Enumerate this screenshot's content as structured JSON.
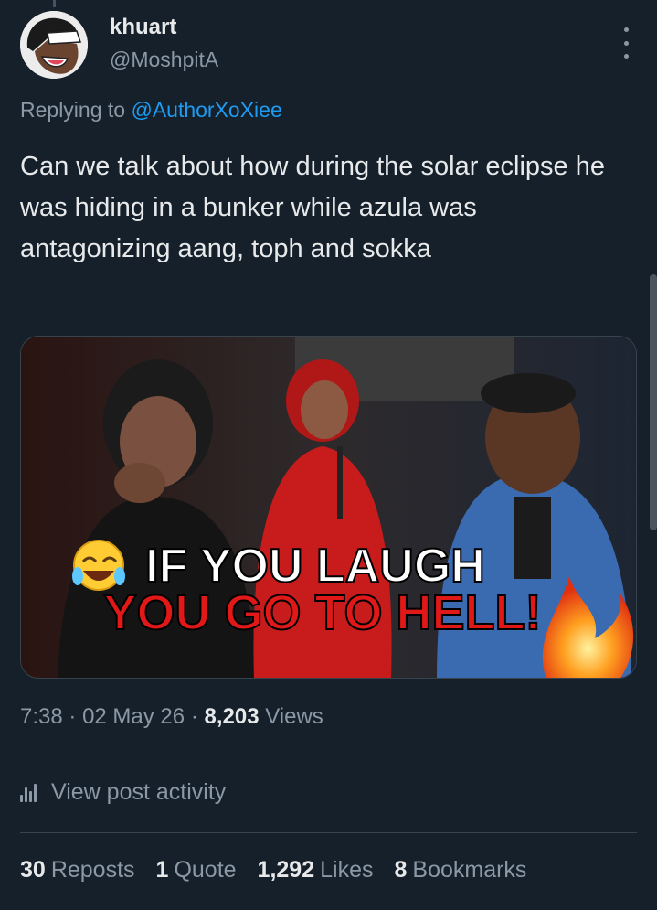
{
  "author": {
    "display_name": "khuart",
    "handle": "@MoshpitA"
  },
  "reply": {
    "prefix": "Replying to",
    "mention": "@AuthorXoXiee"
  },
  "tweet": {
    "text": "Can we talk about how during the solar eclipse he was hiding in a bunker while azula was antagonizing aang, toph and sokka"
  },
  "media": {
    "caption_line1": "IF YOU LAUGH",
    "caption_line2": "YOU GO TO HELL!",
    "emoji_laugh": "😂",
    "emoji_fire": "🔥"
  },
  "meta": {
    "time": "7:38",
    "date": "02 May 26",
    "views_count": "8,203",
    "views_label": "Views",
    "separator": "·"
  },
  "activity": {
    "label": "View post activity"
  },
  "stats": {
    "reposts_count": "30",
    "reposts_label": "Reposts",
    "quote_count": "1",
    "quote_label": "Quote",
    "likes_count": "1,292",
    "likes_label": "Likes",
    "bookmarks_count": "8",
    "bookmarks_label": "Bookmarks"
  },
  "colors": {
    "background": "#15202b",
    "text_primary": "#e7e9ea",
    "text_secondary": "#8b98a5",
    "link": "#1d9bf0",
    "divider": "#38444d"
  }
}
